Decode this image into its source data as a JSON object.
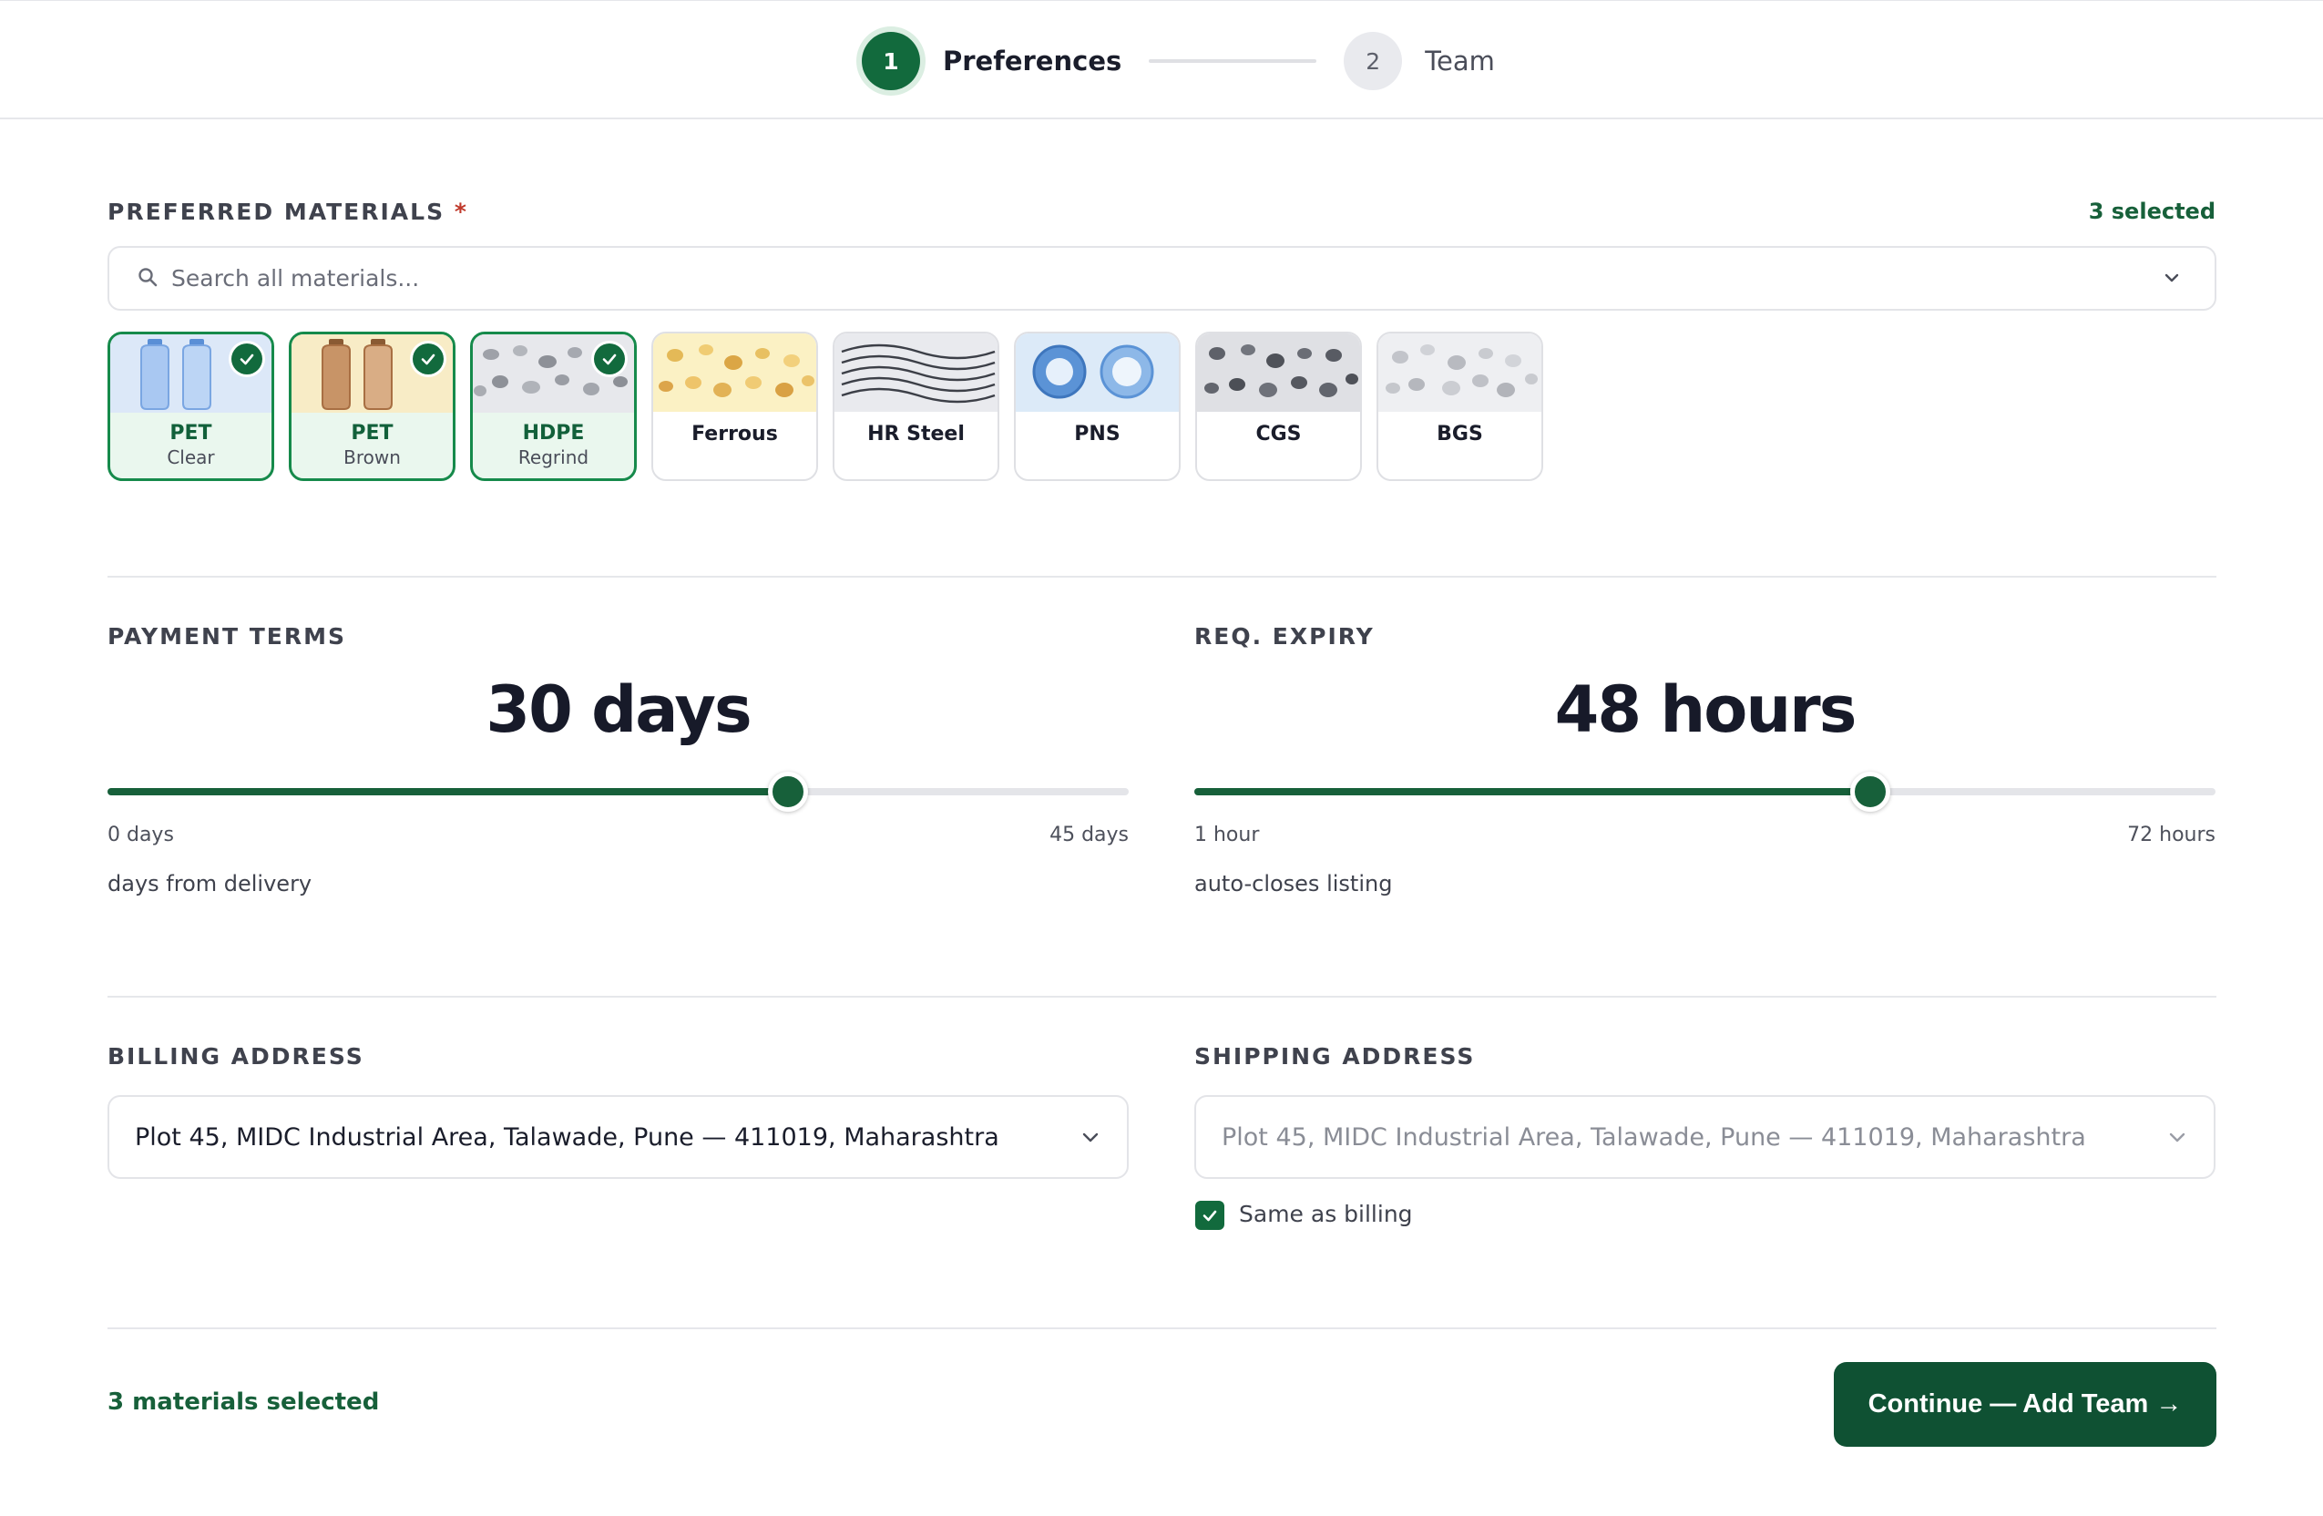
{
  "stepper": {
    "steps": [
      {
        "num": "1",
        "label": "Preferences",
        "state": "active"
      },
      {
        "num": "2",
        "label": "Team",
        "state": "idle"
      }
    ]
  },
  "materials": {
    "title": "PREFERRED MATERIALS",
    "required_mark": "*",
    "selected_count_label": "3 selected",
    "search_placeholder": "Search all materials...",
    "items": [
      {
        "name": "PET",
        "sub": "Clear",
        "selected": true,
        "icon": "clear-bottles"
      },
      {
        "name": "PET",
        "sub": "Brown",
        "selected": true,
        "icon": "brown-bottles"
      },
      {
        "name": "HDPE",
        "sub": "Regrind",
        "selected": true,
        "icon": "grey-pellets"
      },
      {
        "name": "Ferrous",
        "sub": "",
        "selected": false,
        "icon": "yellow-pellets"
      },
      {
        "name": "HR Steel",
        "sub": "",
        "selected": false,
        "icon": "steel-waves"
      },
      {
        "name": "PNS",
        "sub": "",
        "selected": false,
        "icon": "blue-rings"
      },
      {
        "name": "CGS",
        "sub": "",
        "selected": false,
        "icon": "dark-grey-pellets"
      },
      {
        "name": "BGS",
        "sub": "",
        "selected": false,
        "icon": "light-grey-pellets"
      }
    ]
  },
  "payment": {
    "title": "PAYMENT TERMS",
    "value_label": "30 days",
    "value": 30,
    "min": 0,
    "max": 45,
    "min_label": "0 days",
    "max_label": "45 days",
    "hint": "days from delivery"
  },
  "expiry": {
    "title": "REQ. EXPIRY",
    "value_label": "48 hours",
    "value": 48,
    "min": 1,
    "max": 72,
    "min_label": "1 hour",
    "max_label": "72 hours",
    "hint": "auto-closes listing"
  },
  "billing": {
    "title": "BILLING ADDRESS",
    "value": "Plot 45, MIDC Industrial Area, Talawade, Pune — 411019, Maharashtra"
  },
  "shipping": {
    "title": "SHIPPING ADDRESS",
    "value": "Plot 45, MIDC Industrial Area, Talawade, Pune — 411019, Maharashtra",
    "same_as_billing_label": "Same as billing",
    "same_as_billing": true
  },
  "footer": {
    "count_label": "3 materials selected",
    "cta_label": "Continue — Add Team →"
  },
  "colors": {
    "accent": "#126a3d",
    "accent_dark": "#0f5133",
    "selected_tile_bg": "#eaf7ee"
  }
}
